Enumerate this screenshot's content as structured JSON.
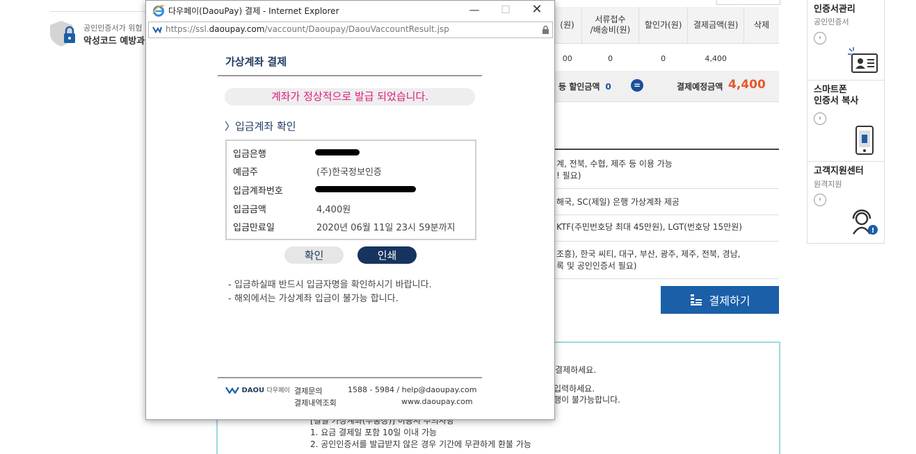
{
  "background": {
    "security_line1": "공인인증서가 위험",
    "security_line2": "악성코드 예방과",
    "table_headers": [
      "(원)",
      "서류접수\n/배송비(원)",
      "할인가(원)",
      "결제금액(원)",
      "삭제"
    ],
    "table_row": [
      "00",
      "0",
      "0",
      "4,400"
    ],
    "summary_discount_label": "등 할인금액",
    "summary_discount_value": "0",
    "summary_equals": "=",
    "summary_total_label": "결제예정금액",
    "summary_total_value": "4,400",
    "list_lines": [
      "계, 전북, 수협, 제주 등 이용 가능",
      "! 필요)",
      "해국, SC(제일) 은행 가상계좌 제공",
      "KTF(주민번호당 최대 45만원), LGT(번호당 15만원)",
      "조흥), 한국 씨티, 대구, 부산, 광주, 제주, 전북, 경남,",
      "록 및 공인인증서 필요)"
    ],
    "pay_button": "결제하기",
    "info_lines": [
      "결제하세요.",
      "입력하세요.",
      "행이 불가능합니다.",
      "[결필 가상계좌(무통장)] 이용시 주의사항",
      "1. 요금 결제일 포함 10일 이내 가능",
      "2. 공인인증서를 발급받지 않은 경우 기간에 무관하게 환불 가능"
    ]
  },
  "sidebar": {
    "items": [
      {
        "title": "인증서관리",
        "subtitle": "공인인증서",
        "icon": "id-card-icon"
      },
      {
        "title": "스마트폰\n인증서 복사",
        "subtitle": "",
        "icon": "smartphone-icon"
      },
      {
        "title": "고객지원센터",
        "subtitle": "원격지원",
        "icon": "support-agent-icon"
      }
    ]
  },
  "popup": {
    "window_title": "다우페이(DaouPay) 결제 - Internet Explorer",
    "url_prefix": "https://ssl.",
    "url_domain": "daoupay.com",
    "url_path": "/vaccount/Daoupay/DaouVaccountResult.jsp",
    "title": "가상계좌 결제",
    "notice": "계좌가 정상적으로 발급 되었습니다.",
    "section_title": "〉입금계좌 확인",
    "rows": [
      {
        "label": "입금은행",
        "value": ""
      },
      {
        "label": "예금주",
        "value": "(주)한국정보인증"
      },
      {
        "label": "입금계좌번호",
        "value": ""
      },
      {
        "label": "입금금액",
        "value": "4,400원"
      },
      {
        "label": "입금만료일",
        "value": "2020년 06월 11일 23시 59분까지"
      }
    ],
    "confirm_button": "확인",
    "print_button": "인쇄",
    "notes": [
      "- 입금하실때 반드시 입금자명을 확인하시기 바랍니다.",
      "- 해외에서는 가상계좌 입금이 불가능 합니다."
    ],
    "footer": {
      "logo": "DAOU",
      "logo_sub": "다우페이",
      "link1": "결제문의",
      "link2": "결제내역조회",
      "contact": "1588 - 5984 / help@daoupay.com",
      "site": "www.daoupay.com"
    }
  },
  "colors": {
    "accent_blue": "#1a5fa8",
    "navy": "#16345f",
    "total_orange": "#e8572b",
    "notice_pink": "#e0197d"
  }
}
